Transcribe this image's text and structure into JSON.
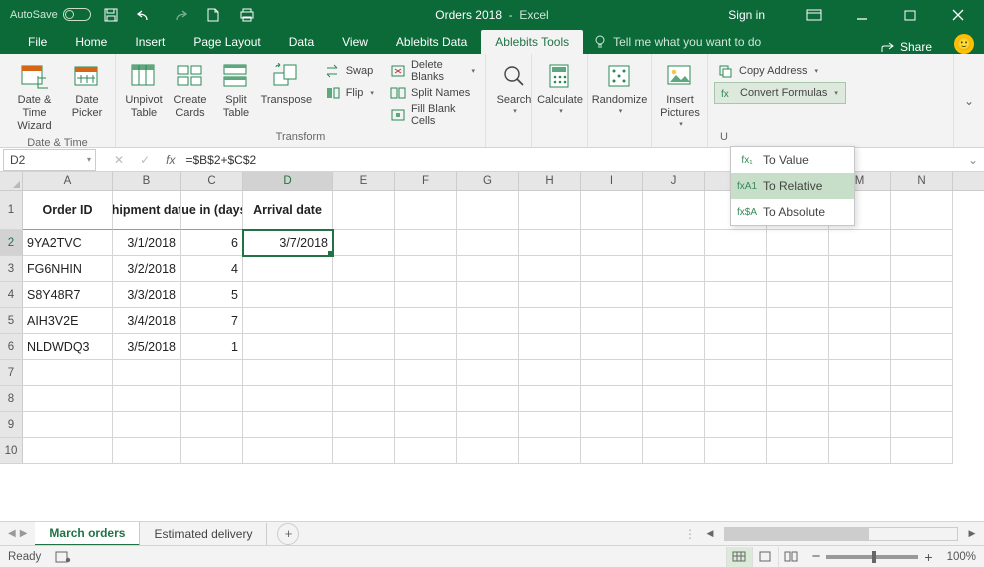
{
  "titlebar": {
    "autosave": "AutoSave",
    "workbook": "Orders 2018",
    "app": "Excel",
    "signin": "Sign in"
  },
  "tabs": {
    "file": "File",
    "home": "Home",
    "insert": "Insert",
    "pagelayout": "Page Layout",
    "data": "Data",
    "view": "View",
    "ablebitsdata": "Ablebits Data",
    "ablebitstools": "Ablebits Tools",
    "tellme": "Tell me what you want to do",
    "share": "Share"
  },
  "ribbon": {
    "datetime": {
      "datewizard": "Date &\nTime Wizard",
      "datepicker": "Date\nPicker",
      "label": "Date & Time"
    },
    "transform": {
      "unpivot": "Unpivot\nTable",
      "createcards": "Create\nCards",
      "splittable": "Split\nTable",
      "transpose": "Transpose",
      "swap": "Swap",
      "flip": "Flip",
      "deleteblanks": "Delete Blanks",
      "splitnames": "Split Names",
      "fillblank": "Fill Blank Cells",
      "label": "Transform"
    },
    "search": "Search",
    "calculate": "Calculate",
    "randomize": "Randomize",
    "insertpics": "Insert\nPictures",
    "utils": {
      "copyaddr": "Copy Address",
      "convert": "Convert Formulas",
      "tovalue": "To Value",
      "torelative": "To Relative",
      "toabsolute": "To Absolute",
      "label": "U"
    }
  },
  "formulabar": {
    "cellref": "D2",
    "formula": "=$B$2+$C$2"
  },
  "columns": [
    "A",
    "B",
    "C",
    "D",
    "E",
    "F",
    "G",
    "H",
    "I",
    "J",
    "K",
    "L",
    "M",
    "N"
  ],
  "headers": {
    "A": "Order ID",
    "B": "Shipment date",
    "C": "Due in (days)",
    "D": "Arrival date"
  },
  "rows": [
    {
      "n": "2",
      "A": "9YA2TVC",
      "B": "3/1/2018",
      "C": "6",
      "D": "3/7/2018"
    },
    {
      "n": "3",
      "A": "FG6NHIN",
      "B": "3/2/2018",
      "C": "4",
      "D": ""
    },
    {
      "n": "4",
      "A": "S8Y48R7",
      "B": "3/3/2018",
      "C": "5",
      "D": ""
    },
    {
      "n": "5",
      "A": "AIH3V2E",
      "B": "3/4/2018",
      "C": "7",
      "D": ""
    },
    {
      "n": "6",
      "A": "NLDWDQ3",
      "B": "3/5/2018",
      "C": "1",
      "D": ""
    },
    {
      "n": "7",
      "A": "",
      "B": "",
      "C": "",
      "D": ""
    },
    {
      "n": "8",
      "A": "",
      "B": "",
      "C": "",
      "D": ""
    },
    {
      "n": "9",
      "A": "",
      "B": "",
      "C": "",
      "D": ""
    },
    {
      "n": "10",
      "A": "",
      "B": "",
      "C": "",
      "D": ""
    }
  ],
  "sheets": {
    "active": "March orders",
    "other": "Estimated delivery"
  },
  "status": {
    "ready": "Ready",
    "zoom": "100%"
  }
}
